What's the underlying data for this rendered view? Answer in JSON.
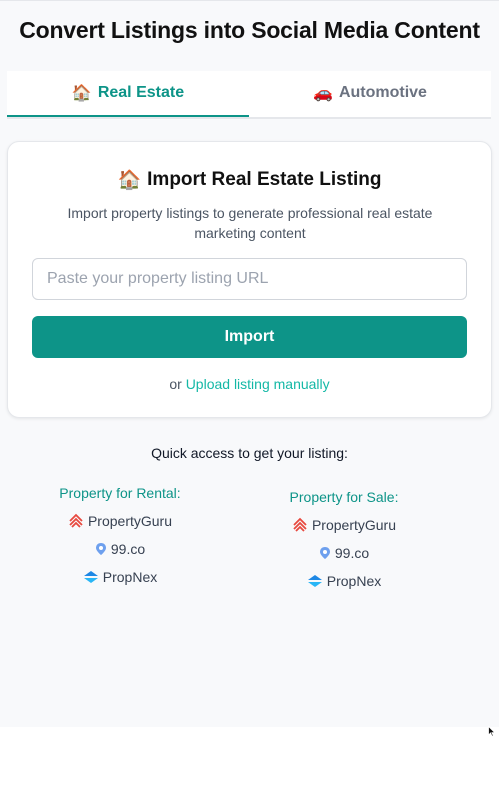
{
  "header": {
    "title": "Convert Listings into Social Media Content"
  },
  "tabs": [
    {
      "icon": "🏠",
      "label": "Real Estate",
      "active": true
    },
    {
      "icon": "🚗",
      "label": "Automotive",
      "active": false
    }
  ],
  "import_card": {
    "icon": "🏠",
    "title": "Import Real Estate Listing",
    "description": "Import property listings to generate professional real estate marketing content",
    "url_placeholder": "Paste your property listing URL",
    "url_value": "",
    "import_label": "Import",
    "or_text": "or",
    "manual_link": "Upload listing manually"
  },
  "quick_access": {
    "title": "Quick access to get your listing:",
    "rental": {
      "heading": "Property for Rental:",
      "sources": [
        {
          "name": "PropertyGuru",
          "icon": "propertyguru-icon"
        },
        {
          "name": "99.co",
          "icon": "99co-icon"
        },
        {
          "name": "PropNex",
          "icon": "propnex-icon"
        }
      ]
    },
    "sale": {
      "heading": "Property for Sale:",
      "sources": [
        {
          "name": "PropertyGuru",
          "icon": "propertyguru-icon"
        },
        {
          "name": "99.co",
          "icon": "99co-icon"
        },
        {
          "name": "PropNex",
          "icon": "propnex-icon"
        }
      ]
    }
  },
  "colors": {
    "accent": "#0d9488",
    "link": "#14b8a6",
    "background": "#f8f9fb"
  }
}
